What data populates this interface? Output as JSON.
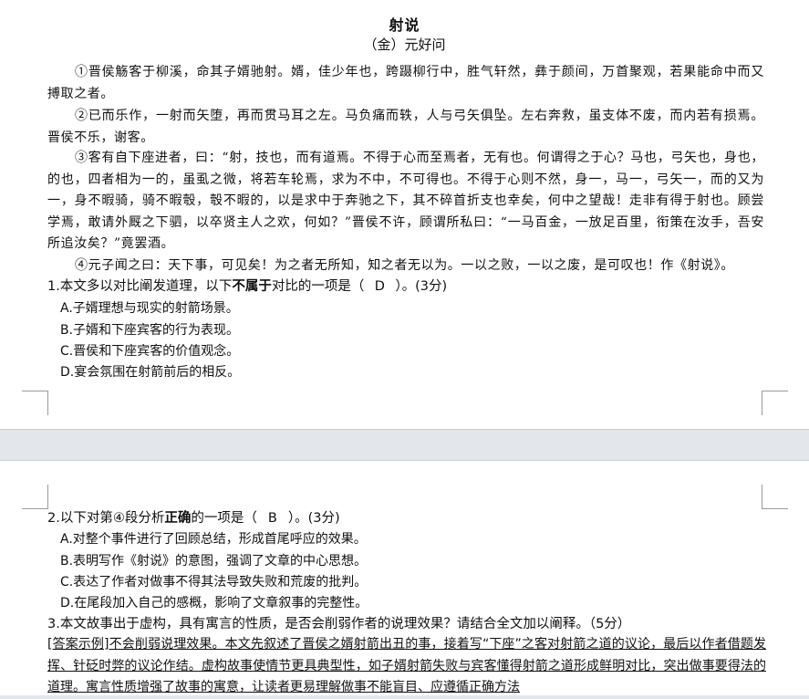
{
  "passage": {
    "title": "射说",
    "author": "（金）元好问",
    "paragraphs": [
      "①晋侯觞客于柳溪，命其子婿驰射。婿，佳少年也，跨蹑柳行中，胜气轩然，彝于颜间，万首聚观，若果能命中而又搏取之者。",
      "②已而乐作，一射而矢堕，再而贯马耳之左。马负痛而轶，人与弓矢俱坠。左右奔救，虽支体不废，而内若有损焉。晋侯不乐，谢客。",
      "③客有自下座进者，曰：“射，技也，而有道焉。不得于心而至焉者，无有也。何谓得之于心？马也，弓矢也，身也，的也，四者相为一的，虽虱之微，将若车轮焉，求为不中，不可得也。不得于心则不然，身一，马一，弓矢一，而的又为一，身不暇骑，骑不暇彀，彀不暇的，以是求中于奔驰之下，其不碎首折支也幸矣，何中之望哉！走非有得于射也。顾尝学焉，敢请外厩之下驷，以卒贤主人之欢，何如？”晋侯不许，顾谓所私曰：“一马百金，一放足百里，衔策在汝手，吾安所追汝矣？”竟罢酒。",
      "④元子闻之曰：天下事，可见矣！为之者无所知，知之者无以为。一以之败，一以之废，是可叹也！作《射说》。"
    ]
  },
  "q1": {
    "stem_pre": "1.本文多以对比阐发道理，以下",
    "stem_bold": "不属于",
    "stem_mid": "对比的一项是（",
    "answer": "D",
    "stem_post": "）。(3分)",
    "options": [
      "A.子婿理想与现实的射箭场景。",
      "B.子婿和下座宾客的行为表现。",
      "C.晋侯和下座宾客的价值观念。",
      "D.宴会氛围在射箭前后的相反。"
    ]
  },
  "q2": {
    "stem_pre": "2.以下对第④段分析",
    "stem_bold": "正确",
    "stem_mid": "的一项是（",
    "answer": "B",
    "stem_post": "）。(3分)",
    "options": [
      "A.对整个事件进行了回顾总结，形成首尾呼应的效果。",
      "B.表明写作《射说》的意图，强调了文章的中心思想。",
      "C.表达了作者对做事不得其法导致失败和荒废的批判。",
      "D.在尾段加入自己的感概，影响了文章叙事的完整性。"
    ]
  },
  "q3": {
    "stem": "3.本文故事出于虚构，具有寓言的性质，是否会削弱作者的说理效果？请结合全文加以阐释。（5分）",
    "answer": "[答案示例]不会削弱说理效果。本文先叙述了晋侯之婿射箭出丑的事，接着写“下座”之客对射箭之道的议论，最后以作者借题发挥、针砭时弊的议论作结。虚构故事使情节更具典型性，如子婿射箭失败与宾客懂得射箭之道形成鲜明对比，突出做事要得法的道理。寓言性质增强了故事的寓意，让读者更易理解做事不能盲目、应遵循正确方法"
  }
}
